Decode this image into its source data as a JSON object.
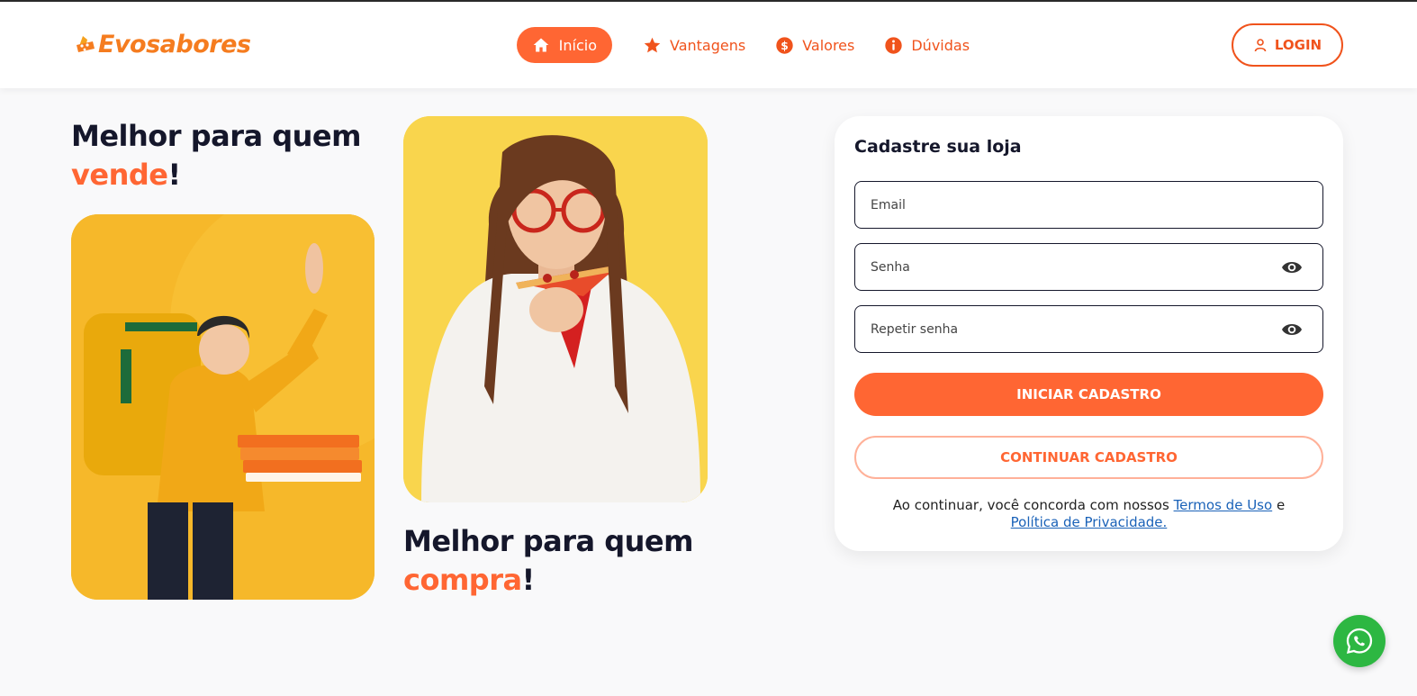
{
  "brand": {
    "name": "Evosabores",
    "text": "Evosabores",
    "color": "#f57c1f"
  },
  "nav": {
    "items": [
      {
        "label": "Início",
        "icon": "home-icon",
        "active": true
      },
      {
        "label": "Vantagens",
        "icon": "star-icon",
        "active": false
      },
      {
        "label": "Valores",
        "icon": "dollar-icon",
        "active": false
      },
      {
        "label": "Dúvidas",
        "icon": "info-icon",
        "active": false
      }
    ],
    "login_label": "LOGIN"
  },
  "hero": {
    "sell": {
      "line1": "Melhor para quem",
      "accent": "vende",
      "suffix": "!"
    },
    "buy": {
      "line1": "Melhor para quem",
      "accent": "compra",
      "suffix": "!"
    }
  },
  "form": {
    "title": "Cadastre sua loja",
    "email": {
      "placeholder": "Email",
      "value": ""
    },
    "password": {
      "placeholder": "Senha",
      "value": ""
    },
    "repeat_password": {
      "placeholder": "Repetir senha",
      "value": ""
    },
    "primary_button": "INICIAR CADASTRO",
    "secondary_button": "CONTINUAR CADASTRO",
    "terms": {
      "prefix": "Ao continuar, você concorda com nossos",
      "terms_link": "Termos de Uso",
      "conjunction": "e",
      "privacy_link": "Política de Privacidade."
    }
  },
  "colors": {
    "accent": "#ff6633",
    "nav_text": "#f0531c",
    "heading": "#15172b",
    "link": "#1a62b8",
    "whatsapp": "#2db742"
  },
  "icons": {
    "whatsapp": "whatsapp-icon",
    "eye": "eye-icon",
    "user": "user-icon"
  }
}
